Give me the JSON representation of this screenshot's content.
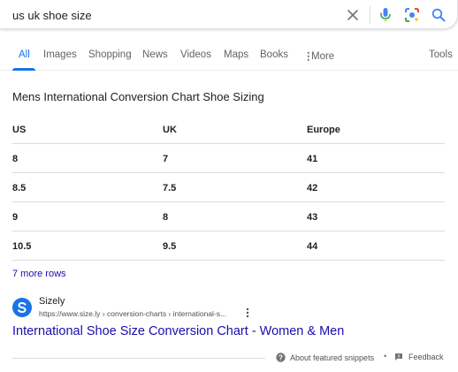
{
  "search": {
    "query": "us uk shoe size"
  },
  "tabs": [
    {
      "label": "All"
    },
    {
      "label": "Images"
    },
    {
      "label": "Shopping"
    },
    {
      "label": "News"
    },
    {
      "label": "Videos"
    },
    {
      "label": "Maps"
    },
    {
      "label": "Books"
    },
    {
      "label": "More"
    }
  ],
  "tools_label": "Tools",
  "snippet": {
    "title": "Mens International Conversion Chart Shoe Sizing",
    "columns": [
      "US",
      "UK",
      "Europe"
    ],
    "rows": [
      [
        "8",
        "7",
        "41"
      ],
      [
        "8.5",
        "7.5",
        "42"
      ],
      [
        "9",
        "8",
        "43"
      ],
      [
        "10.5",
        "9.5",
        "44"
      ]
    ],
    "more_rows_label": "7 more rows"
  },
  "result": {
    "site_name": "Sizely",
    "url": "https://www.size.ly › conversion-charts › international-s...",
    "title": "International Shoe Size Conversion Chart - Women & Men"
  },
  "footer": {
    "about_label": "About featured snippets",
    "separator": "•",
    "feedback_label": "Feedback"
  },
  "colors": {
    "link": "#1a0dab",
    "accent": "#1a73e8",
    "text": "#202124"
  },
  "icons": [
    "clear-icon",
    "microphone-icon",
    "lens-icon",
    "search-icon",
    "more-dots-icon",
    "favicon-s-icon",
    "kebab-icon",
    "help-icon",
    "feedback-icon"
  ]
}
